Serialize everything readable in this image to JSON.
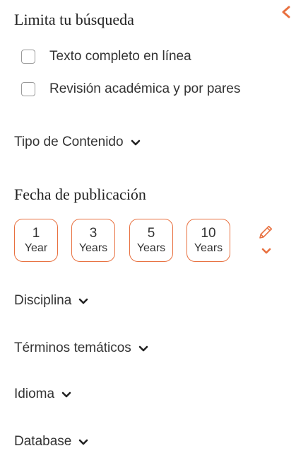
{
  "colors": {
    "accent": "#e8703f",
    "text": "#333333"
  },
  "icons": {
    "collapse": "chevron-left-icon",
    "edit": "pencil-icon",
    "expand": "chevron-down-icon"
  },
  "limit": {
    "title": "Limita tu búsqueda",
    "options": [
      {
        "label": "Texto completo en línea",
        "checked": false
      },
      {
        "label": "Revisión académica y por pares",
        "checked": false
      }
    ]
  },
  "content_type": {
    "label": "Tipo de Contenido"
  },
  "pub_date": {
    "title": "Fecha de publicación",
    "ranges": [
      {
        "value": "1",
        "unit": "Year"
      },
      {
        "value": "3",
        "unit": "Years"
      },
      {
        "value": "5",
        "unit": "Years"
      },
      {
        "value": "10",
        "unit": "Years"
      }
    ]
  },
  "facets": [
    {
      "label": "Disciplina"
    },
    {
      "label": "Términos temáticos"
    },
    {
      "label": "Idioma"
    },
    {
      "label": "Database"
    }
  ]
}
